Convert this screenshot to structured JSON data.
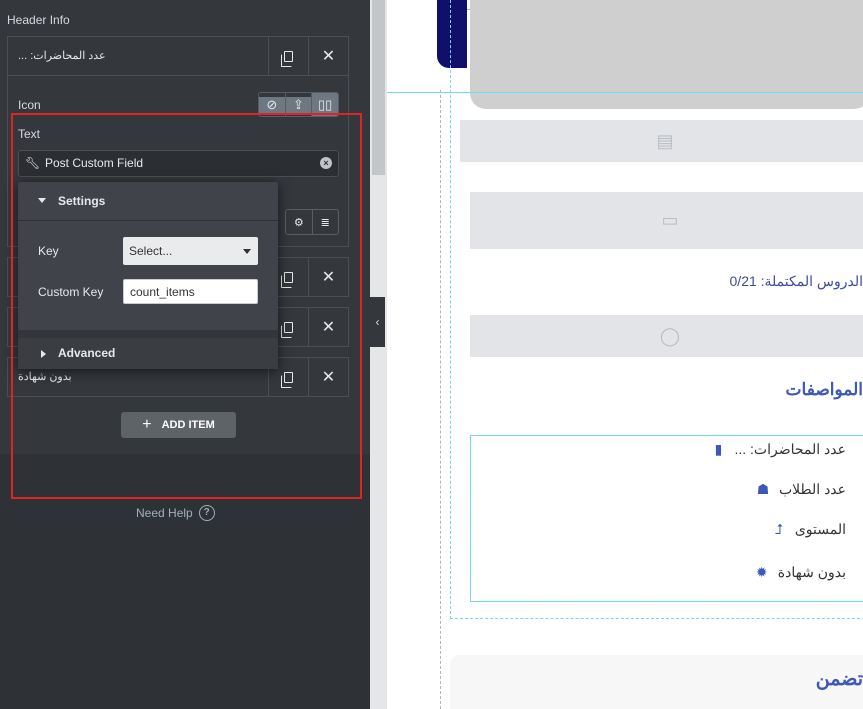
{
  "panel": {
    "header_info_label": "Header Info",
    "items": [
      {
        "title": "عدد المحاضرات: ..."
      },
      {
        "title": ""
      },
      {
        "title": ""
      },
      {
        "title": "بدون شهادة"
      }
    ],
    "icon_label": "Icon",
    "text_label": "Text",
    "text_value": "Post Custom Field",
    "popover": {
      "settings_label": "Settings",
      "key_label": "Key",
      "key_value": "Select...",
      "custom_key_label": "Custom Key",
      "custom_key_value": "count_items",
      "advanced_label": "Advanced"
    },
    "add_item_label": "ADD ITEM",
    "need_help_label": "Need Help"
  },
  "preview": {
    "progress_text": "الدروس المكتملة: 0/21",
    "specs_heading": "المواصفات",
    "specs": [
      {
        "icon": "book-icon",
        "text": "عدد المحاضرات: ..."
      },
      {
        "icon": "graduate-icon",
        "text": "عدد الطلاب"
      },
      {
        "icon": "level-arrow-icon",
        "text": "المستوى"
      },
      {
        "icon": "certificate-icon",
        "text": "بدون شهادة"
      }
    ],
    "lower_heading": "تضمن"
  },
  "colors": {
    "panel_bg": "#34383c",
    "accent_blue": "#3d59b5",
    "highlight_red": "#e02424",
    "selection_cyan": "#71d7f7"
  }
}
